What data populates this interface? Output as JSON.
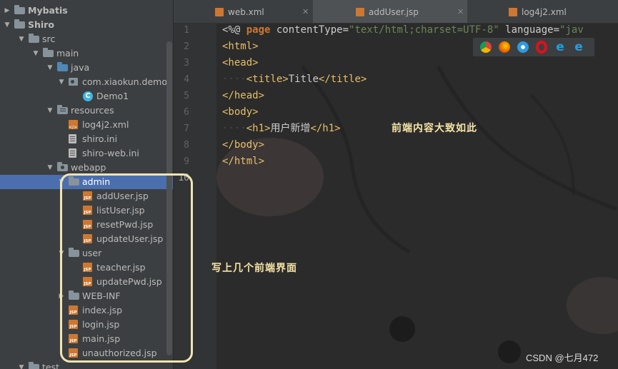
{
  "project_tree": [
    {
      "label": "Mybatis",
      "arrow": "▶",
      "icon": "folder",
      "bold": true
    },
    {
      "label": "Shiro",
      "arrow": "▼",
      "icon": "folder",
      "bold": true
    },
    {
      "label": "src",
      "arrow": "▼",
      "icon": "folder"
    },
    {
      "label": "main",
      "arrow": "▼",
      "icon": "folder"
    },
    {
      "label": "java",
      "arrow": "▼",
      "icon": "folder-blue"
    },
    {
      "label": "com.xiaokun.demo",
      "arrow": "▼",
      "icon": "package"
    },
    {
      "label": "Demo1",
      "arrow": "",
      "icon": "class"
    },
    {
      "label": "resources",
      "arrow": "▼",
      "icon": "folder-resources"
    },
    {
      "label": "log4j2.xml",
      "arrow": "",
      "icon": "file-xml"
    },
    {
      "label": "shiro.ini",
      "arrow": "",
      "icon": "file-ini"
    },
    {
      "label": "shiro-web.ini",
      "arrow": "",
      "icon": "file-ini"
    },
    {
      "label": "webapp",
      "arrow": "▼",
      "icon": "folder-web"
    },
    {
      "label": "admin",
      "arrow": "▼",
      "icon": "folder",
      "selected": true
    },
    {
      "label": "addUser.jsp",
      "arrow": "",
      "icon": "file-jsp"
    },
    {
      "label": "listUser.jsp",
      "arrow": "",
      "icon": "file-jsp"
    },
    {
      "label": "resetPwd.jsp",
      "arrow": "",
      "icon": "file-jsp"
    },
    {
      "label": "updateUser.jsp",
      "arrow": "",
      "icon": "file-jsp"
    },
    {
      "label": "user",
      "arrow": "▼",
      "icon": "folder"
    },
    {
      "label": "teacher.jsp",
      "arrow": "",
      "icon": "file-jsp"
    },
    {
      "label": "updatePwd.jsp",
      "arrow": "",
      "icon": "file-jsp"
    },
    {
      "label": "WEB-INF",
      "arrow": "▶",
      "icon": "folder"
    },
    {
      "label": "index.jsp",
      "arrow": "",
      "icon": "file-jsp"
    },
    {
      "label": "login.jsp",
      "arrow": "",
      "icon": "file-jsp"
    },
    {
      "label": "main.jsp",
      "arrow": "",
      "icon": "file-jsp"
    },
    {
      "label": "unauthorized.jsp",
      "arrow": "",
      "icon": "file-jsp"
    },
    {
      "label": "test",
      "arrow": "▼",
      "icon": "folder"
    }
  ],
  "tabs": [
    {
      "label": "web.xml",
      "icon": "file-xml-icon",
      "active": false
    },
    {
      "label": "addUser.jsp",
      "icon": "file-jsp-icon",
      "active": true
    },
    {
      "label": "log4j2.xml",
      "icon": "file-xml-icon",
      "active": false
    }
  ],
  "line_numbers": [
    "1",
    "2",
    "3",
    "4",
    "5",
    "6",
    "7",
    "8",
    "9",
    "10"
  ],
  "code": {
    "l1": {
      "open": "<%@ ",
      "kw": "page",
      "attr1": " contentType=",
      "val1": "\"text/html;charset=UTF-8\"",
      "attr2": " language=",
      "val2": "\"jav"
    },
    "l2": "<html>",
    "l3": "<head>",
    "l4": {
      "indent": "····",
      "open": "<title>",
      "text": "Title",
      "close": "</title>"
    },
    "l5": "</head>",
    "l6": "<body>",
    "l7": {
      "indent": "····",
      "open": "<h1>",
      "text": "用户新增",
      "close": "</h1>"
    },
    "l8": "</body>",
    "l9": "</html>"
  },
  "browser_icons": [
    "chrome-icon",
    "firefox-icon",
    "safari-icon",
    "opera-icon",
    "ie-icon",
    "edge-icon"
  ],
  "annotations": {
    "editor_note": "前端内容大致如此",
    "tree_note": "写上几个前端界面"
  },
  "watermark": "CSDN @七月472",
  "colors": {
    "selection": "#4b6eaf",
    "annotation": "#f4e3a6",
    "tag": "#e8bf6a",
    "keyword": "#cc7832",
    "string": "#6a8759"
  }
}
